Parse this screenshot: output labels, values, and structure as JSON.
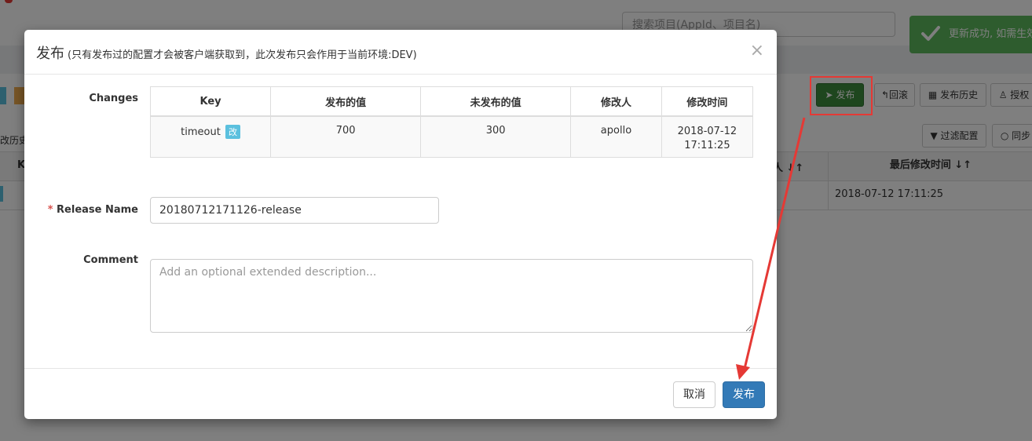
{
  "background": {
    "search_placeholder": "搜索项目(AppId、项目名)",
    "toast_text": "更新成功, 如需生效",
    "left_text": "改历史",
    "table_key_header": "K",
    "table_sort_header": "人 ↓↑",
    "toolbar": {
      "publish": "发布",
      "rollback": "回滚",
      "history": "发布历史",
      "auth": "授权",
      "filter": "过滤配置",
      "sync": "同步"
    },
    "last_modified_header": "最后修改时间 ↓↑",
    "last_modified_value": "2018-07-12 17:11:25"
  },
  "modal": {
    "title": "发布",
    "subtitle": "(只有发布过的配置才会被客户端获取到，此次发布只会作用于当前环境:DEV)",
    "close": "×",
    "changes_label": "Changes",
    "table": {
      "headers": [
        "Key",
        "发布的值",
        "未发布的值",
        "修改人",
        "修改时间"
      ],
      "rows": [
        {
          "key": "timeout",
          "badge": "改",
          "released": "700",
          "unreleased": "300",
          "modifier": "apollo",
          "time": "2018-07-12 17:11:25"
        }
      ]
    },
    "release_name_label": "Release Name",
    "release_name_required": "*",
    "release_name_value": "20180712171126-release",
    "comment_label": "Comment",
    "comment_placeholder": "Add an optional extended description...",
    "cancel": "取消",
    "publish": "发布"
  },
  "colors": {
    "primary": "#337ab7",
    "success": "#5cb85c",
    "highlight": "#e53935",
    "info_badge": "#5bc0de"
  }
}
